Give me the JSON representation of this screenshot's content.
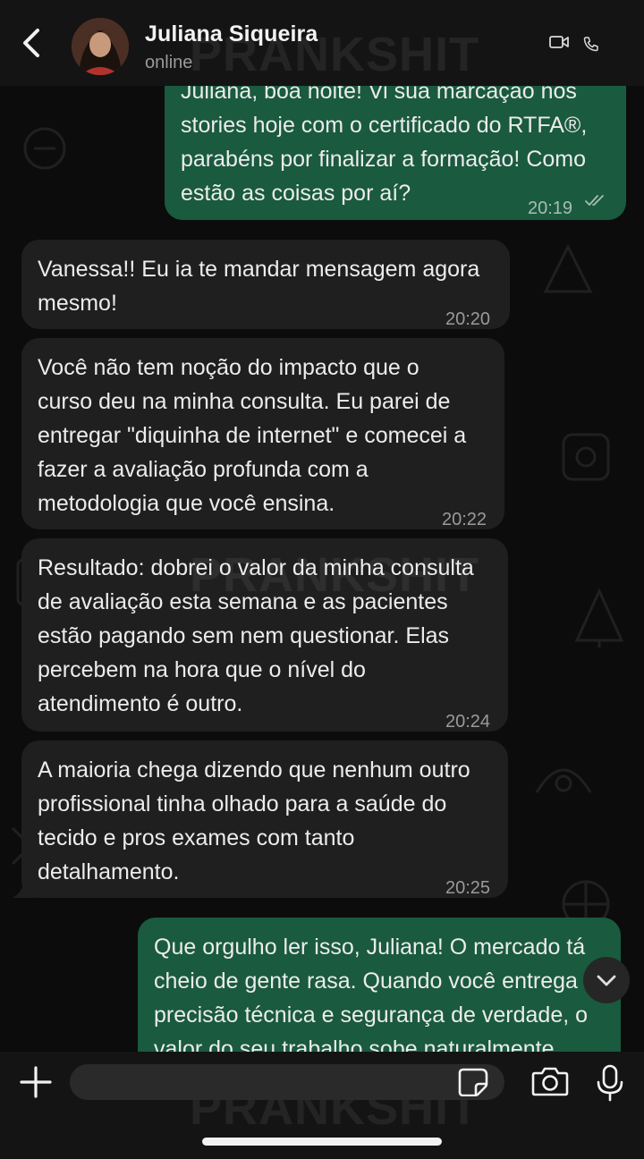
{
  "header": {
    "contact_name": "Juliana Siqueira",
    "status": "online"
  },
  "watermark": "PRANKSHIT",
  "messages": [
    {
      "direction": "out",
      "text": "Juliana, boa noite! Vi sua marcação nos\nstories hoje com o certificado do RTFA®,\nparabéns por finalizar a formação! Como\nestão as coisas por aí?",
      "time": "20:19",
      "status": "read"
    },
    {
      "direction": "in",
      "text": "Vanessa!! Eu ia te mandar mensagem agora\nmesmo!",
      "time": "20:20"
    },
    {
      "direction": "in",
      "text": "Você não tem noção do impacto que o\ncurso deu na minha consulta. Eu parei de\nentregar \"diquinha de internet\" e comecei a\nfazer a avaliação profunda com a\nmetodologia que você ensina.",
      "time": "20:22"
    },
    {
      "direction": "in",
      "text": "Resultado: dobrei o valor da minha consulta\nde avaliação esta semana e as pacientes\nestão pagando sem nem questionar. Elas\npercebem na hora que o nível do\natendimento é outro.",
      "time": "20:24"
    },
    {
      "direction": "in",
      "text": "A maioria chega dizendo que nenhum outro\nprofissional tinha olhado para a saúde do\ntecido e pros exames com tanto\ndetalhamento.",
      "time": "20:25"
    },
    {
      "direction": "out",
      "text": "Que orgulho ler isso, Juliana! O mercado tá\ncheio de gente rasa. Quando você entrega\nprecisão técnica e segurança de verdade, o\nvalor do seu trabalho sobe naturalmente.",
      "time": ""
    }
  ],
  "input": {
    "value": ""
  },
  "icons": {
    "back": "chevron-left-icon",
    "video": "video-camera-icon",
    "call": "phone-icon",
    "read": "double-check-icon",
    "scroll": "chevron-down-icon",
    "attach": "plus-icon",
    "sticker": "sticker-icon",
    "camera": "camera-icon",
    "mic": "microphone-icon"
  },
  "colors": {
    "incoming_bubble": "#1f1f1f",
    "outgoing_bubble": "#1a5a3f",
    "header": "#141414",
    "background": "#0c0c0c"
  }
}
